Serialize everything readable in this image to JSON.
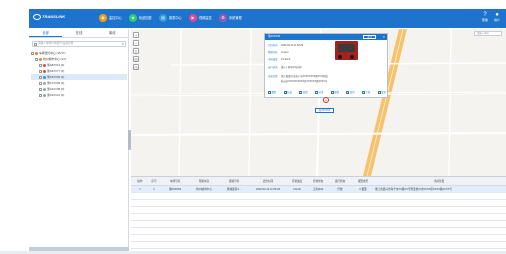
{
  "header": {
    "logo_text": "TRANSLINK",
    "nav": [
      {
        "label": "监控中心",
        "icon": "monitor-icon",
        "color": "#f39c12"
      },
      {
        "label": "轨迹回放",
        "icon": "track-icon",
        "color": "#2ecc71"
      },
      {
        "label": "报表中心",
        "icon": "report-icon",
        "color": "#3498db"
      },
      {
        "label": "视频监控",
        "icon": "video-icon",
        "color": "#e84393"
      },
      {
        "label": "系统管理",
        "icon": "settings-icon",
        "color": "#9b59b6"
      }
    ],
    "right_items": [
      {
        "label": "帮助",
        "icon": "help-icon"
      },
      {
        "label": "用户",
        "icon": "user-icon"
      }
    ]
  },
  "left_panel": {
    "tabs": [
      "全部",
      "在线",
      "离线"
    ],
    "active_tab": 0,
    "search_placeholder": "请输入车牌号/终端号/设备名称",
    "tree": [
      {
        "label": "车辆监控中心 (15/17)",
        "level": 0,
        "selected": false
      },
      {
        "label": "杭州城市中心 (4/7)",
        "level": 1,
        "selected": false
      },
      {
        "label": "浙A8XX13 (0)",
        "level": 2,
        "selected": false
      },
      {
        "label": "浙A6XX77 (0)",
        "level": 2,
        "selected": false
      },
      {
        "label": "浙A5XX69 (0)",
        "level": 2,
        "selected": true
      },
      {
        "label": "浙A7XX09 (0)",
        "level": 2,
        "selected": false
      },
      {
        "label": "浙A2XX48 (0)",
        "level": 2,
        "selected": false
      },
      {
        "label": "浙A3XX21 (0)",
        "level": 2,
        "selected": false
      }
    ]
  },
  "map": {
    "search_placeholder": "请输入地址",
    "popup": {
      "plate": "浙A5XX69",
      "follow_button": "关注",
      "fields": [
        {
          "key": "定位时间",
          "value": "2020-02-12 11:53:29"
        },
        {
          "key": "所属车队",
          "value": "Xxxxxx"
        },
        {
          "key": "当前速度",
          "value": "0.0 km/h"
        },
        {
          "key": "运行状态",
          "value": "熄火 | 停车(10分钟)"
        },
        {
          "key": "当前位置",
          "value": "浙江省嘉兴市海宁市XXXXXXXX路XX号附近"
        },
        {
          "key": "",
          "value": "杭州市XXXXXXXXXX区XXXXXX路XXXX号"
        }
      ],
      "actions": [
        "跟踪",
        "轨迹",
        "拍照",
        "对讲",
        "视频",
        "监听",
        "下发",
        "更多"
      ]
    },
    "vehicle_label": "浙A5XX69"
  },
  "table": {
    "columns": [
      "操作",
      "序号",
      "车牌号码",
      "所属车队",
      "终端号码",
      "定位时间",
      "行驶速度",
      "行驶状态",
      "运行状态",
      "报警类型",
      "当前位置"
    ],
    "rows": [
      [
        "□",
        "1",
        "浙A5XX69",
        "杭州城市中心",
        "浙城运营X...",
        "2020-02-12 11:53:29",
        "0 km/h",
        "正常(0/0)",
        "行驶",
        "0 报警",
        "浙江省嘉兴市海宁市XX路XX号附近杭州市XXXX区XXXX路XXXX号"
      ]
    ],
    "empty_rows": 9
  }
}
